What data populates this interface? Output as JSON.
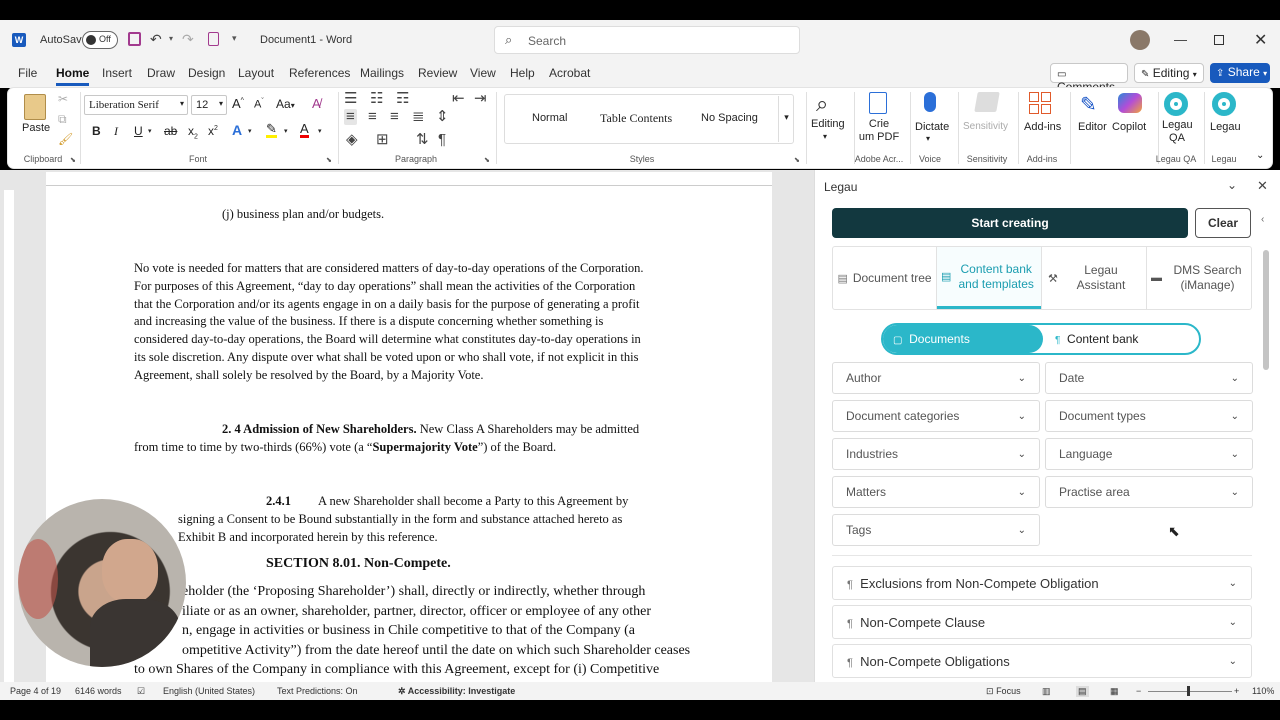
{
  "titlebar": {
    "autosave": "AutoSave",
    "toggle": "Off",
    "document": "Document1",
    "app": "Word",
    "separator": "-",
    "search_placeholder": "Search"
  },
  "menu": {
    "tabs": [
      "File",
      "Home",
      "Insert",
      "Draw",
      "Design",
      "Layout",
      "References",
      "Mailings",
      "Review",
      "View",
      "Help",
      "Acrobat"
    ],
    "comments": "Comments",
    "editing": "Editing",
    "share": "Share"
  },
  "ribbon": {
    "paste": "Paste",
    "clipboard": "Clipboard",
    "font_name": "Liberation Serif",
    "font_size": "12",
    "font": "Font",
    "paragraph": "Paragraph",
    "styles": [
      "Normal",
      "Table Contents",
      "No Spacing"
    ],
    "styles_label": "Styles",
    "editing": "Editing",
    "crie1": "Crie",
    "crie2": "um PDF",
    "adobe": "Adobe Acr...",
    "dictate": "Dictate",
    "voice": "Voice",
    "sensitivity": "Sensitivity",
    "sensitivity_label": "Sensitivity",
    "addins": "Add-ins",
    "addins_label": "Add-ins",
    "editor": "Editor",
    "copilot": "Copilot",
    "legau_qa1": "Legau",
    "legau_qa2": "QA",
    "legau_qa_label": "Legau QA",
    "legau": "Legau",
    "legau_label": "Legau"
  },
  "document": {
    "p1": "(j) business plan and/or budgets.",
    "p2_lines": [
      "No vote is needed for matters that are considered matters of day-to-day operations of the Corporation.",
      "For purposes of this Agreement, “day to day operations” shall mean the activities of the Corporation",
      "that the Corporation and/or its agents engage in on a daily basis for the purpose of generating a profit",
      "and increasing the value of the business. If there is a dispute concerning whether something is",
      "considered day-to-day operations, the Board will determine what constitutes day-to-day operations in",
      "its sole discretion. Any dispute over what shall be voted upon or who shall vote, if not explicit in this",
      "Agreement, shall solely be resolved by the Board, by a Majority Vote."
    ],
    "s24_bold": "2. 4 Admission of New Shareholders.",
    "s24_rest": " New Class A Shareholders may be admitted",
    "s24_line2a": "from time to time by two-thirds (66%) vote (a “",
    "s24_line2b": "Supermajority Vote",
    "s24_line2c": "”) of the Board.",
    "s241_num": "2.4.1",
    "s241_l1": "A new Shareholder shall become a Party to this Agreement by",
    "s241_l2": "signing a Consent to be Bound substantially in the form and substance attached hereto as",
    "s241_l3": "Exhibit B and incorporated herein by this reference.",
    "section_title": "SECTION 8.01. Non-Compete.",
    "nc_lines": [
      "eholder (the ‘Proposing Shareholder’) shall, directly or indirectly, whether through",
      "iliate or as an owner, shareholder, partner, director, officer or employee of any other",
      "n, engage in activities or business in Chile competitive to that of the Company (a",
      "ompetitive Activity”) from the date hereof until the date on which such Shareholder ceases",
      "to own Shares of the Company in compliance with this Agreement, except for (i) Competitive"
    ]
  },
  "pane": {
    "title": "Legau",
    "start": "Start creating",
    "clear": "Clear",
    "tabs": [
      {
        "label": "Document tree"
      },
      {
        "label": "Content bank and templates"
      },
      {
        "label": "Legau Assistant"
      },
      {
        "label": "DMS Search (iManage)"
      }
    ],
    "toggle_documents": "Documents",
    "toggle_content": "Content bank",
    "filters": [
      "Author",
      "Date",
      "Document categories",
      "Document types",
      "Industries",
      "Language",
      "Matters",
      "Practise area",
      "Tags"
    ],
    "items": [
      "Exclusions from Non-Compete Obligation",
      "Non-Compete Clause",
      "Non-Compete Obligations"
    ]
  },
  "status": {
    "page": "Page 4 of 19",
    "words": "6146 words",
    "language": "English (United States)",
    "predictions": "Text Predictions: On",
    "accessibility": "Accessibility: Investigate",
    "focus": "Focus",
    "zoom": "110%"
  },
  "colors": {
    "accent": "#2b88d8",
    "legau_dark": "#12383f",
    "legau_teal": "#2bb7c9",
    "word_blue": "#185abd"
  }
}
